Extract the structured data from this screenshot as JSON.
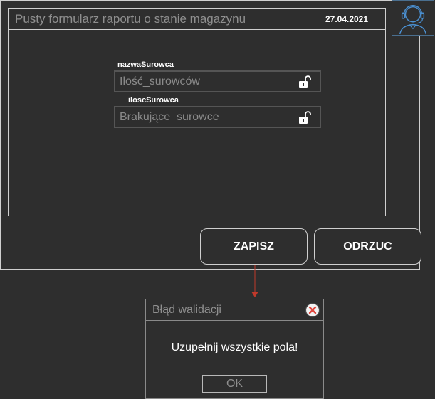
{
  "form": {
    "title": "Pusty formularz raportu o stanie magazynu",
    "date": "27.04.2021",
    "fields": [
      {
        "label": "nazwaSurowca",
        "placeholder": "Ilość_surowców",
        "icon": "unlocked-padlock-icon"
      },
      {
        "label": "iloscSurowca",
        "placeholder": "Brakujące_surowce",
        "icon": "unlocked-padlock-icon"
      }
    ]
  },
  "buttons": {
    "save_label": "ZAPISZ",
    "reject_label": "ODRZUC"
  },
  "user": {
    "icon": "user-headset-avatar-icon"
  },
  "dialog": {
    "title": "Błąd walidacji",
    "message": "Uzupełnij wszystkie pola!",
    "ok_label": "OK",
    "close_icon": "close-x-circle-icon"
  },
  "colors": {
    "background": "#2e2e2e",
    "border": "#cfcfcf",
    "muted_text": "#8f8f8f",
    "arrow": "#c0392b",
    "close_icon": "#e0473e",
    "avatar": "#4a8fd0"
  }
}
